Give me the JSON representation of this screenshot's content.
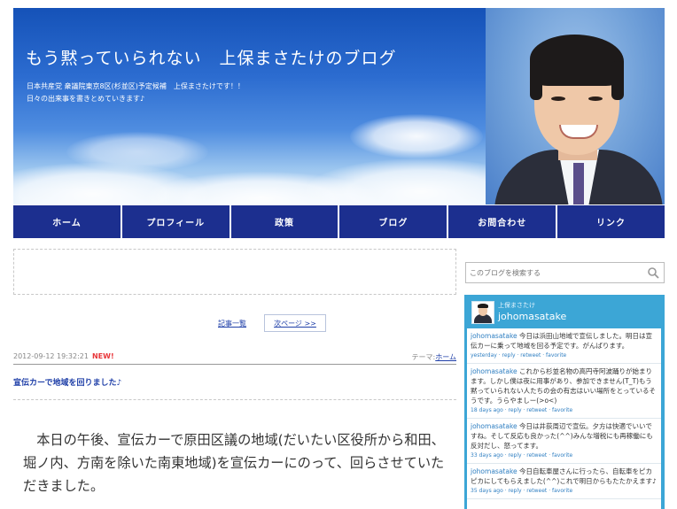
{
  "header": {
    "title": "もう黙っていられない　上保まさたけのブログ",
    "description_lines": [
      "日本共産党 衆議院東京8区(杉並区)予定候補　上保まさたけです！！",
      "日々の出来事を書きとめていきます♪"
    ]
  },
  "nav": {
    "items": [
      {
        "label": "ホーム"
      },
      {
        "label": "プロフィール"
      },
      {
        "label": "政策"
      },
      {
        "label": "ブログ"
      },
      {
        "label": "お問合わせ"
      },
      {
        "label": "リンク"
      }
    ]
  },
  "pager": {
    "list_label": "記事一覧",
    "next_label": "次ページ >>"
  },
  "entry": {
    "date": "2012-09-12 19:32:21",
    "new_badge": "NEW!",
    "theme_prefix": "テーマ:",
    "theme_link": "ホーム",
    "title": "宣伝カーで地域を回りました♪",
    "body": "　本日の午後、宣伝カーで原田区議の地域(だいたい区役所から和田、堀ノ内、方南を除いた南東地域)を宣伝カーにのって、回らさせていただきました。"
  },
  "search": {
    "placeholder": "このブログを検索する"
  },
  "twitter": {
    "display_name": "上保まさたけ",
    "handle": "johomasatake",
    "tweets": [
      {
        "user": "johomasatake",
        "text": " 今日は浜田山地域で宣伝しました。明日は宣伝カーに乗って地域を回る予定です。がんばります。",
        "meta": "yesterday · reply · retweet · favorite"
      },
      {
        "user": "johomasatake",
        "text": " これから杉並名物の高円寺阿波踊りが始まります。しかし僕は夜に用事があり、参加できません(T_T)もう黙っていられない人たちの会の有志はいい場所をとっているそうです。うらやましー(>o<)",
        "meta": "18 days ago · reply · retweet · favorite"
      },
      {
        "user": "johomasatake",
        "text": " 今日は井荻周辺で宣伝。夕方は快適でいいですね。そして反応も良かった(^^)みんな増税にも再稼働にも反対だし、怒ってます。",
        "meta": "33 days ago · reply · retweet · favorite"
      },
      {
        "user": "johomasatake",
        "text": " 今日自転車屋さんに行ったら、自転車をピカピカにしてもらえました(^^)これで明日からもたたかえます♪",
        "meta": "35 days ago · reply · retweet · favorite"
      }
    ]
  }
}
